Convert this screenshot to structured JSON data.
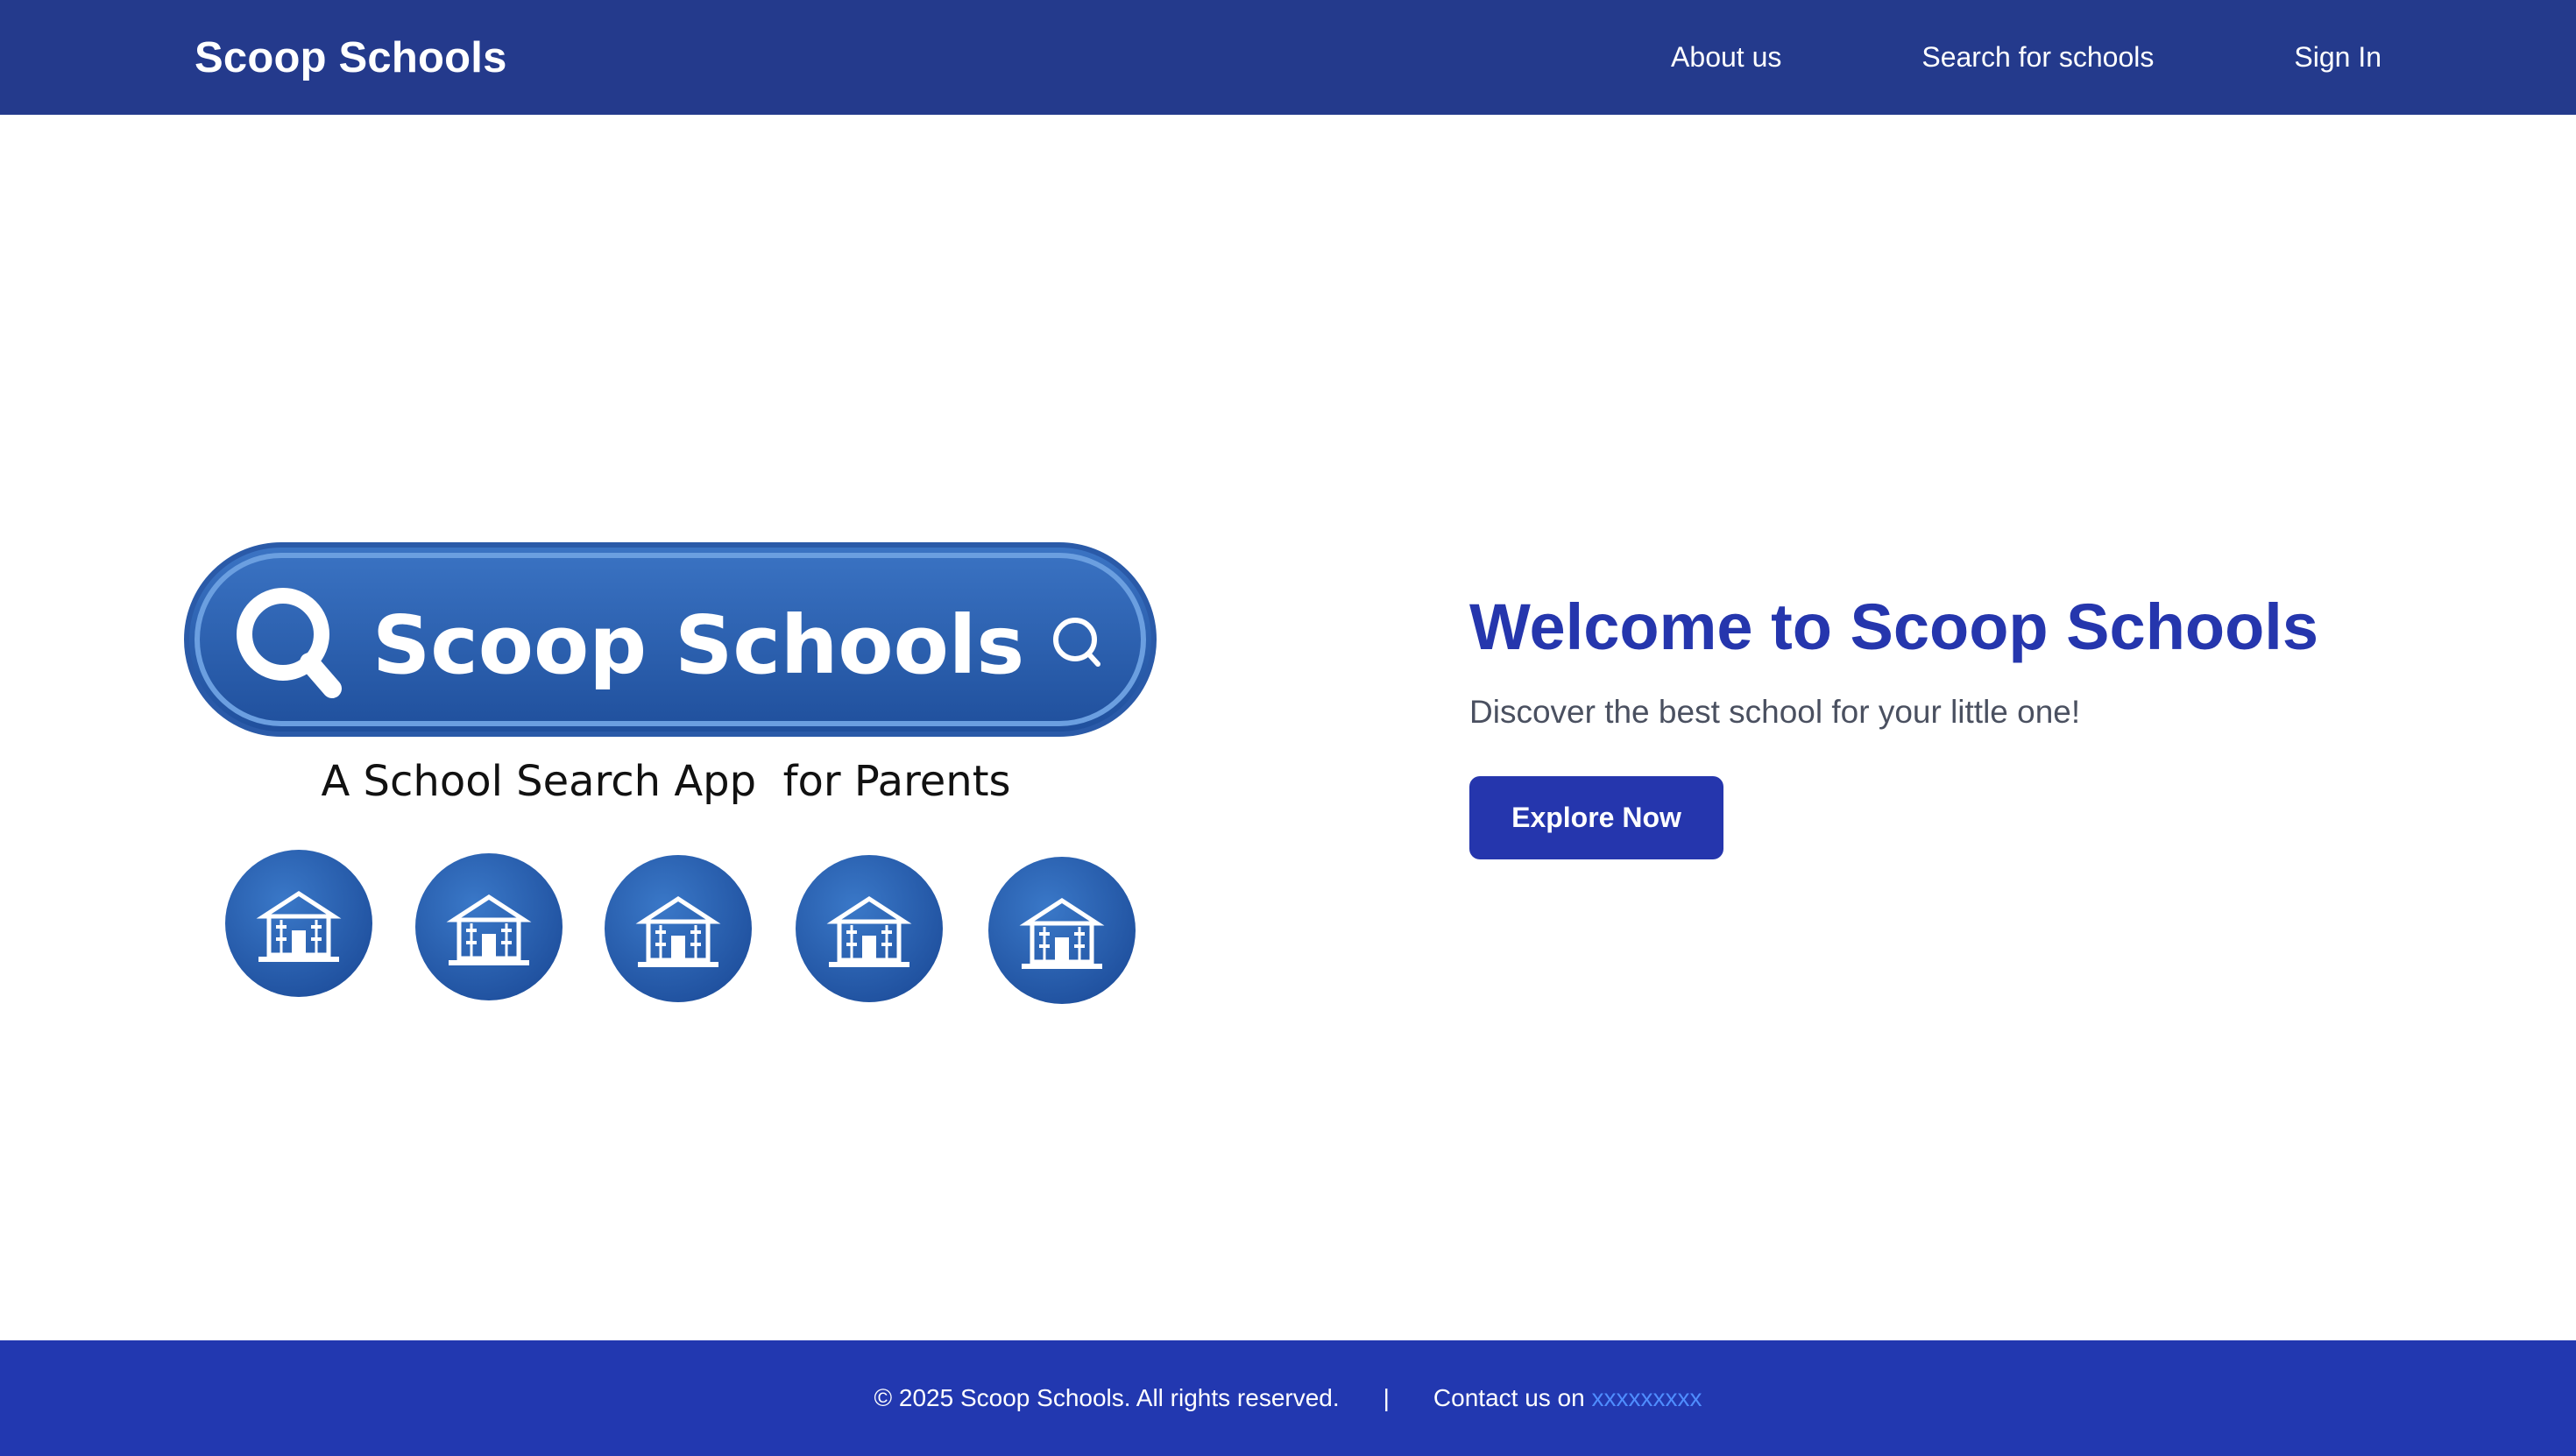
{
  "header": {
    "brand": "Scoop Schools",
    "nav": [
      {
        "label": "About us"
      },
      {
        "label": "Search for schools"
      },
      {
        "label": "Sign In"
      }
    ]
  },
  "logo": {
    "title": "Scoop Schools",
    "tagline": "A School Search App  for Parents",
    "icons": [
      "magnifier-icon",
      "search-icon",
      "school-building-icon"
    ],
    "colors": {
      "pill": "#2f64b3",
      "pill_border": "#5b8fd6",
      "circle": "#2f64b3"
    }
  },
  "hero": {
    "title": "Welcome to Scoop Schools",
    "subtitle": "Discover the best school for your little one!",
    "cta_label": "Explore Now"
  },
  "footer": {
    "copyright": "© 2025 Scoop Schools. All rights reserved.",
    "separator": "|",
    "contact_prefix": "Contact us on ",
    "contact_link": "xxxxxxxxx"
  },
  "colors": {
    "navbar": "#243a8c",
    "accent": "#2536ad",
    "footer": "#2238b0",
    "link": "#4f8dff"
  }
}
